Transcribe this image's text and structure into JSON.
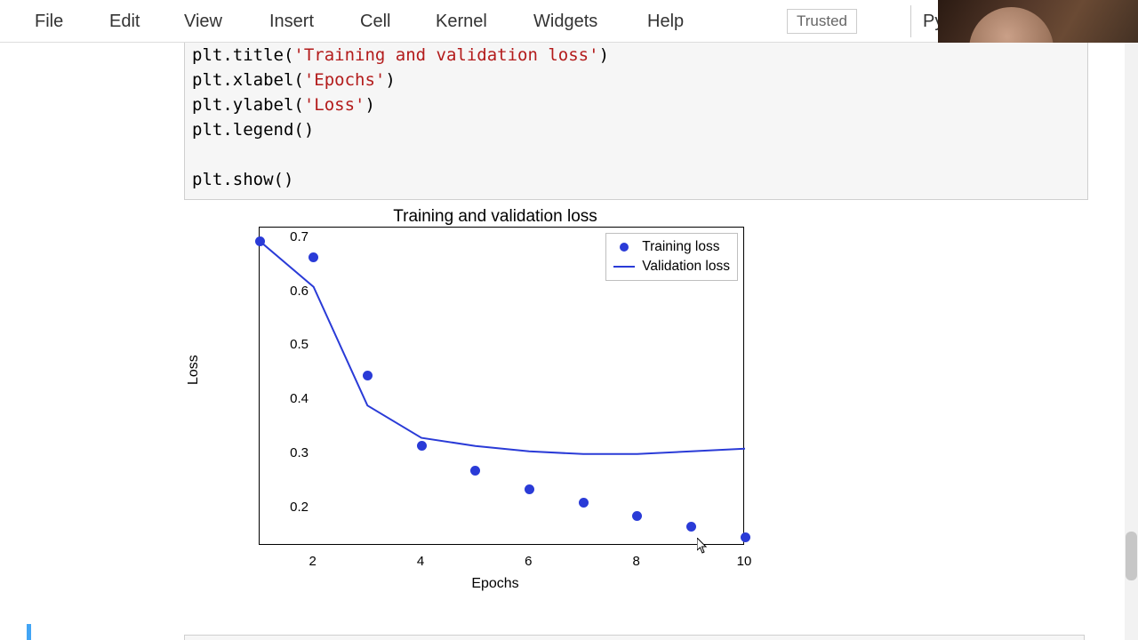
{
  "menu": {
    "file": "File",
    "edit": "Edit",
    "view": "View",
    "insert": "Insert",
    "cell": "Cell",
    "kernel": "Kernel",
    "widgets": "Widgets",
    "help": "Help"
  },
  "trusted": "Trusted",
  "kernel_name": "Py",
  "code": {
    "l1_a": "plt.title(",
    "l1_b": "'Training and validation loss'",
    "l1_c": ")",
    "l2_a": "plt.xlabel(",
    "l2_b": "'Epochs'",
    "l2_c": ")",
    "l3_a": "plt.ylabel(",
    "l3_b": "'Loss'",
    "l3_c": ")",
    "l4": "plt.legend()",
    "l5": "",
    "l6": "plt.show()"
  },
  "chart_data": {
    "type": "mixed",
    "title": "Training and validation loss",
    "xlabel": "Epochs",
    "ylabel": "Loss",
    "xlim": [
      1,
      10
    ],
    "ylim": [
      0.13,
      0.72
    ],
    "xticks": [
      2,
      4,
      6,
      8,
      10
    ],
    "yticks": [
      0.2,
      0.3,
      0.4,
      0.5,
      0.6,
      0.7
    ],
    "series": [
      {
        "name": "Training loss",
        "type": "scatter",
        "color": "#2a3bd7",
        "x": [
          1,
          2,
          3,
          4,
          5,
          6,
          7,
          8,
          9,
          10
        ],
        "y": [
          0.695,
          0.665,
          0.445,
          0.315,
          0.27,
          0.235,
          0.21,
          0.185,
          0.165,
          0.145
        ]
      },
      {
        "name": "Validation loss",
        "type": "line",
        "color": "#2a3bd7",
        "x": [
          1,
          2,
          3,
          4,
          5,
          6,
          7,
          8,
          9,
          10
        ],
        "y": [
          0.695,
          0.61,
          0.39,
          0.33,
          0.315,
          0.305,
          0.3,
          0.3,
          0.305,
          0.31
        ]
      }
    ],
    "legend": {
      "training": "Training loss",
      "validation": "Validation loss"
    }
  }
}
